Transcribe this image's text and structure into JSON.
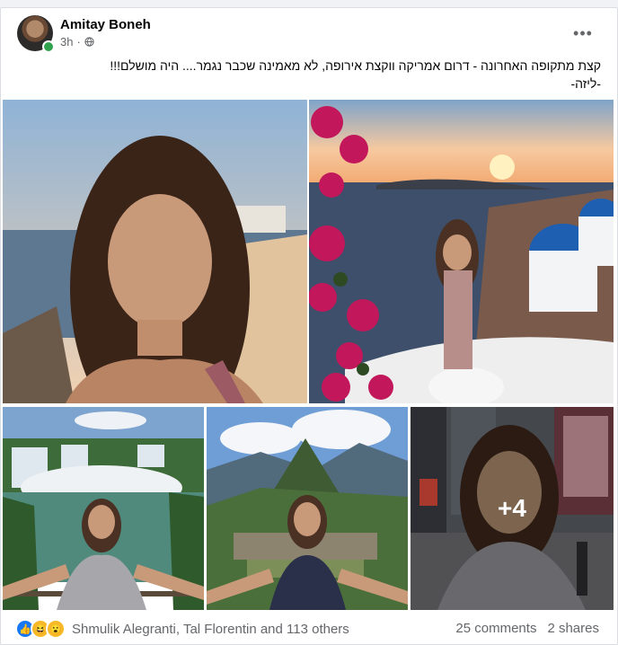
{
  "post": {
    "author": "Amitay Boneh",
    "time": "3h",
    "privacy_icon": "globe-icon",
    "more_icon": "more-options-icon",
    "text_line1": "קצת מתקופה האחרונה - דרום אמריקה ווקצת אירופה, לא מאמינה שכבר נגמר.... היה מושלם!!!",
    "text_line2": "-ליזה-"
  },
  "media": {
    "photos": [
      "beach-selfie-photo",
      "santorini-photo",
      "waterfall-photo",
      "machu-picchu-photo",
      "city-street-photo"
    ],
    "more_count": "+4"
  },
  "footer": {
    "reaction_icons": [
      "like-reaction-icon",
      "haha-reaction-icon",
      "wow-reaction-icon"
    ],
    "reaction_names": "Shmulik Alegranti, Tal Florentin and 113 others",
    "comments": "25 comments",
    "shares": "2 shares"
  },
  "colors": {
    "accent": "#1877f2",
    "online": "#31a24c",
    "secondary_text": "#65676b"
  }
}
